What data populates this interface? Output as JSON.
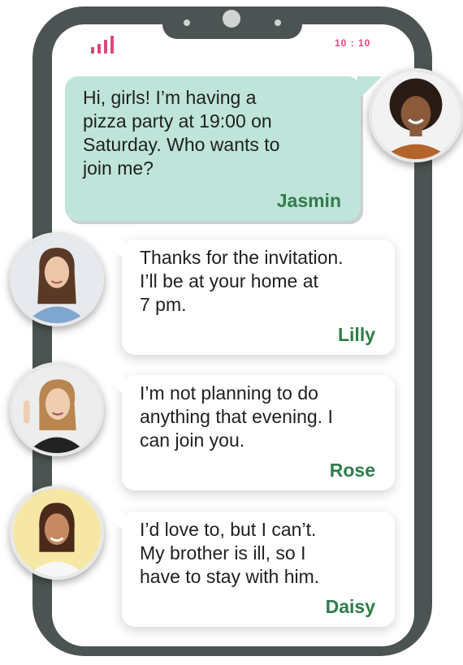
{
  "status_bar": {
    "time": "10 : 10",
    "signal_icon": "signal-bars-icon",
    "accent": "#e0457b"
  },
  "colors": {
    "phone_frame": "#4c5453",
    "sender_name": "#2e7d4a",
    "jasmin_bubble": "#bfe4da"
  },
  "messages": [
    {
      "sender": "Jasmin",
      "text": "Hi, girls! I’m having a\npizza party at 19:00 on\nSaturday. Who wants to\njoin me?"
    },
    {
      "sender": "Lilly",
      "text": "Thanks for the invitation.\nI’ll be at your home at\n7 pm."
    },
    {
      "sender": "Rose",
      "text": "I’m not planning to do\nanything that evening. I\ncan join you."
    },
    {
      "sender": "Daisy",
      "text": "I’d love to, but I can’t.\nMy brother is ill, so I\nhave to stay with him."
    }
  ]
}
